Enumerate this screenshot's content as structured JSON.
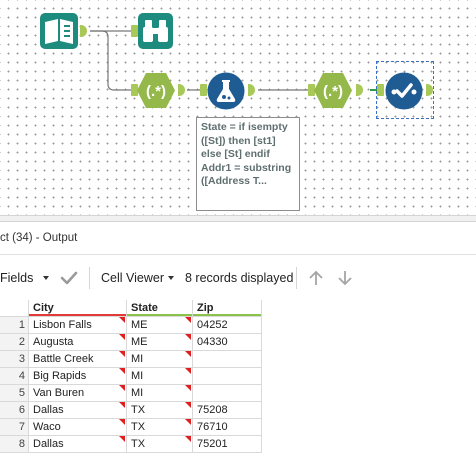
{
  "workflow": {
    "annotation_lines": [
      "State = if isempty",
      "([St]) then [st1]",
      "else [St] endif",
      "Addr1 = substring",
      "([Address T..."
    ],
    "tools": [
      {
        "name": "input-tool",
        "icon": "book-icon"
      },
      {
        "name": "browse-tool",
        "icon": "binoculars-icon"
      },
      {
        "name": "regex-tool-1",
        "icon": "regex-icon"
      },
      {
        "name": "formula-tool",
        "icon": "flask-icon"
      },
      {
        "name": "regex-tool-2",
        "icon": "regex-icon"
      },
      {
        "name": "select-records-tool",
        "icon": "check-line-icon"
      }
    ],
    "colors": {
      "input": "#1d8c7e",
      "regex": "#95b84a",
      "formula": "#1f5c93",
      "select": "#1f5c93"
    }
  },
  "results": {
    "title": "ct (34) - Output",
    "toolbar": {
      "fields_label": "Fields",
      "cell_viewer_label": "Cell Viewer",
      "records_label": "8 records displayed"
    },
    "columns": [
      "City",
      "State",
      "Zip"
    ],
    "rows": [
      {
        "n": "1",
        "city": "Lisbon Falls",
        "state": "ME",
        "zip": "04252"
      },
      {
        "n": "2",
        "city": "Augusta",
        "state": "ME",
        "zip": "04330"
      },
      {
        "n": "3",
        "city": "Battle Creek",
        "state": "MI",
        "zip": ""
      },
      {
        "n": "4",
        "city": "Big Rapids",
        "state": "MI",
        "zip": ""
      },
      {
        "n": "5",
        "city": "Van Buren",
        "state": "MI",
        "zip": ""
      },
      {
        "n": "6",
        "city": "Dallas",
        "state": "TX",
        "zip": "75208"
      },
      {
        "n": "7",
        "city": "Waco",
        "state": "TX",
        "zip": "76710"
      },
      {
        "n": "8",
        "city": "Dallas",
        "state": "TX",
        "zip": "75201"
      }
    ]
  }
}
